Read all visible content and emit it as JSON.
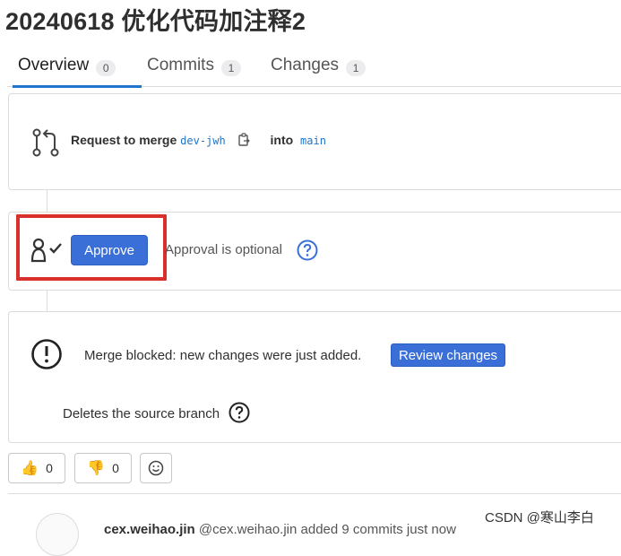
{
  "page": {
    "title": "20240618 优化代码加注释2"
  },
  "tabs": [
    {
      "label": "Overview",
      "count": "0"
    },
    {
      "label": "Commits",
      "count": "1"
    },
    {
      "label": "Changes",
      "count": "1"
    }
  ],
  "merge_request": {
    "prefix": "Request to merge",
    "source_branch": "dev-jwh",
    "into_label": "into",
    "target_branch": "main"
  },
  "approval": {
    "approve_label": "Approve",
    "status_text": "Approval is optional"
  },
  "merge_status": {
    "blocked_text": "Merge blocked: new changes were just added.",
    "review_label": "Review changes",
    "delete_branch_text": "Deletes the source branch"
  },
  "reactions": {
    "thumbs_up_count": "0",
    "thumbs_down_count": "0"
  },
  "activity": {
    "author": "cex.weihao.jin",
    "handle": "@cex.weihao.jin",
    "action": "added 9 commits just now"
  },
  "watermark": "CSDN @寒山李白",
  "colors": {
    "accent": "#3a6fd8",
    "highlight": "#d9302c",
    "link": "#1f75cb"
  }
}
